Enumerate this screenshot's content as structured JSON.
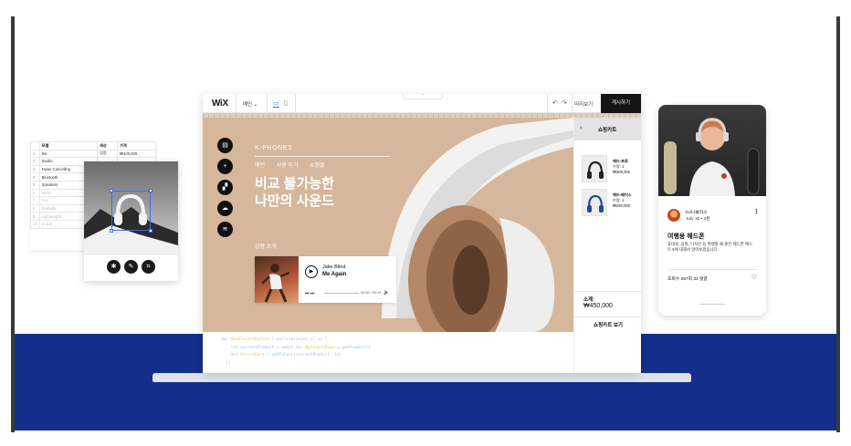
{
  "spreadsheet": {
    "headers": [
      "",
      "모델",
      "색상",
      "가격"
    ],
    "rows": [
      {
        "idx": "1",
        "model": "Ski",
        "color": "검정",
        "price": "₩100,000",
        "faded": false
      },
      {
        "idx": "2",
        "model": "Studio",
        "color": "",
        "price": "",
        "faded": false
      },
      {
        "idx": "3",
        "model": "Noise Cancelling",
        "color": "",
        "price": "",
        "faded": false
      },
      {
        "idx": "4",
        "model": "Bluetooth",
        "color": "",
        "price": "",
        "faded": false
      },
      {
        "idx": "5",
        "model": "Speakers",
        "color": "",
        "price": "",
        "faded": false
      },
      {
        "idx": "6",
        "model": "Music",
        "color": "",
        "price": "",
        "faded": true
      },
      {
        "idx": "7",
        "model": "Pro",
        "color": "",
        "price": "",
        "faded": true
      },
      {
        "idx": "8",
        "model": "Earbuds",
        "color": "",
        "price": "",
        "faded": true
      },
      {
        "idx": "9",
        "model": "Lightweight",
        "color": "",
        "price": "",
        "faded": true
      },
      {
        "idx": "10",
        "model": "In-Ear",
        "color": "",
        "price": "",
        "faded": true
      }
    ]
  },
  "photo_editor": {
    "tools": [
      "settings-icon",
      "pencil-icon",
      "crop-icon"
    ]
  },
  "editor": {
    "toolbar": {
      "logo": "WiX",
      "page": "메인",
      "preview": "미리보기",
      "publish": "게시하기"
    },
    "site": {
      "brand": "K-PHONES",
      "nav": [
        "메인",
        "사용 후기",
        "쇼핑몰"
      ],
      "hero_line1": "비교 불가능한",
      "hero_line2": "나만의 사운드",
      "product_intro": "상품 소개"
    },
    "player": {
      "artist": "Jake Blind",
      "song": "Me Again",
      "time": "00:00 / 03:14"
    },
    "cart": {
      "title": "쇼핑카트",
      "items": [
        {
          "name": "헤드-프로",
          "qty": "수량: 1",
          "price": "₩200,000",
          "color": "#222222"
        },
        {
          "name": "헤드-베이스",
          "qty": "수량: 1",
          "price": "₩250,000",
          "color": "#1f4a9c"
        }
      ],
      "subtotal_label": "소계:",
      "subtotal": "₩450,000",
      "view_cart": "쇼핑카트 보기"
    },
    "code": {
      "line1_a": "$w(",
      "line1_str": "'#addToCartButton'",
      "line1_b": ").onClick(async () => {",
      "line2_a": "    let currentProduct = await $w(",
      "line2_str": "'#productPage'",
      "line2_b": ").getProduct()",
      "line3_a": "    $w(",
      "line3_str": "'#storeCart'",
      "line3_b": ").addToCart(currentProduct._id)",
      "line4": "  })"
    }
  },
  "phone": {
    "author": "DJ니콜리스",
    "meta": "July 16 •  3분",
    "title": "여행용 헤드폰",
    "body": "휴대성, 음질, 디자인 등 여행할 때 좋은 헤드폰 베스트 5에 대해서 알아보겠습니다.",
    "stats": "조회수 257회   32 댓글"
  },
  "colors": {
    "navy": "#142e8c",
    "canvas": "#d6b79b",
    "accent": "#3a6df0"
  }
}
